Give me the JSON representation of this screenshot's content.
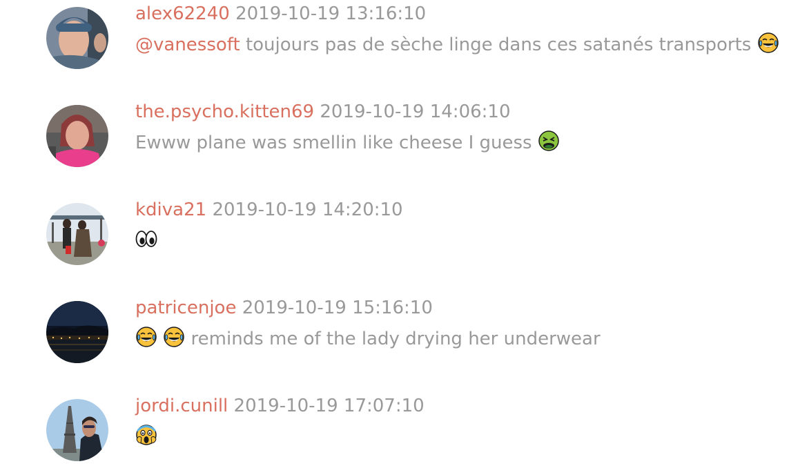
{
  "comments": [
    {
      "username": "alex62240",
      "timestamp": "2019-10-19 13:16:10",
      "mention": "@vanessoft",
      "text": " toujours pas de sèche linge dans ces satanés transports ",
      "emojis": [
        "face-with-tears-of-joy"
      ]
    },
    {
      "username": "the.psycho.kitten69",
      "timestamp": "2019-10-19 14:06:10",
      "text": "Ewww plane was smellin like cheese I guess ",
      "emojis": [
        "nauseated-face"
      ]
    },
    {
      "username": "kdiva21",
      "timestamp": "2019-10-19 14:20:10",
      "text": "",
      "emojis": [
        "eyes"
      ]
    },
    {
      "username": "patricenjoe",
      "timestamp": "2019-10-19 15:16:10",
      "text": " reminds me of the lady drying her underwear",
      "emojis": [
        "face-with-tears-of-joy",
        "face-with-tears-of-joy"
      ]
    },
    {
      "username": "jordi.cunill",
      "timestamp": "2019-10-19 17:07:10",
      "text": "",
      "emojis": [
        "face-screaming-in-fear"
      ]
    }
  ],
  "colors": {
    "username": "#d9705f",
    "meta_text": "#999999",
    "background": "#ffffff"
  }
}
